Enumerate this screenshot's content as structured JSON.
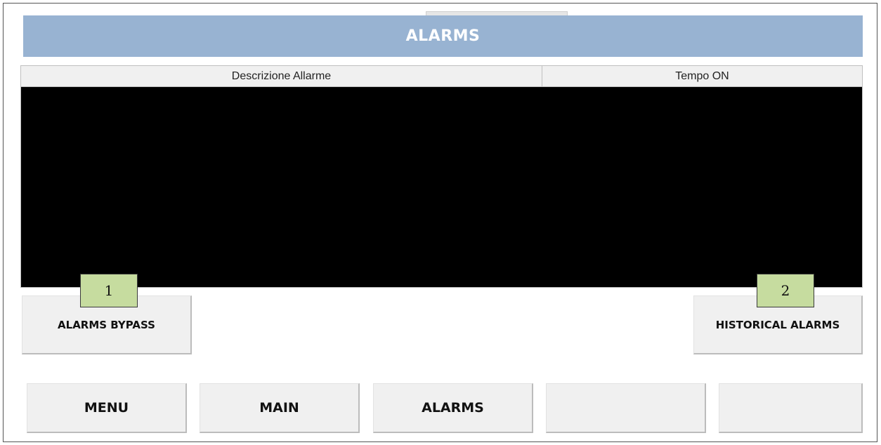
{
  "header": {
    "title": "ALARMS"
  },
  "alarm_table": {
    "columns": [
      "Descrizione Allarme",
      "Tempo ON"
    ],
    "rows": []
  },
  "actions": {
    "bypass_label": "ALARMS BYPASS",
    "historical_label": "HISTORICAL ALARMS"
  },
  "callouts": {
    "one": "1",
    "two": "2"
  },
  "nav": {
    "items": [
      "MENU",
      "MAIN",
      "ALARMS",
      "",
      ""
    ]
  },
  "colors": {
    "title_bar": "#98b3d2",
    "table_body": "#000000",
    "callout_fill": "#c6dc9f",
    "button_face": "#f0f0f0"
  }
}
